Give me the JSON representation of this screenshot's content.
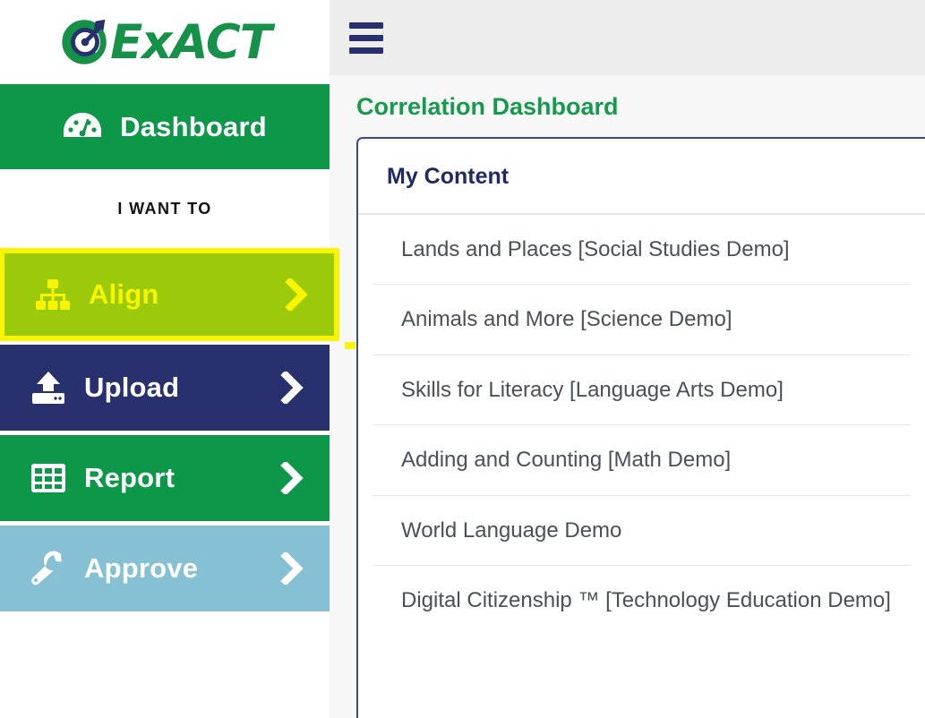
{
  "brand": {
    "logo_text": "ExACT",
    "logo_icon": "target-dart-icon",
    "green": "#159148",
    "navy": "#28306E"
  },
  "sidebar": {
    "dashboard": {
      "label": "Dashboard",
      "icon": "gauge-icon"
    },
    "section_label": "I WANT TO",
    "actions": [
      {
        "label": "Align",
        "icon": "sitemap-icon",
        "chevron": "❯",
        "bg": "#9ACA09",
        "fg": "#F9F500",
        "selected": true
      },
      {
        "label": "Upload",
        "icon": "upload-icon",
        "chevron": "❯",
        "bg": "#28306E",
        "fg": "#FFFFFF",
        "selected": false
      },
      {
        "label": "Report",
        "icon": "table-icon",
        "chevron": "❯",
        "bg": "#0C9749",
        "fg": "#FFFFFF",
        "selected": false
      },
      {
        "label": "Approve",
        "icon": "wrench-icon",
        "chevron": "❯",
        "bg": "#85C0D4",
        "fg": "#FFFFFF",
        "selected": false
      }
    ]
  },
  "header": {
    "menu_icon": "hamburger-menu-icon",
    "page_title": "Correlation Dashboard"
  },
  "content": {
    "card_title": "My Content",
    "items": [
      {
        "label": "Lands and Places [Social Studies Demo]"
      },
      {
        "label": "Animals and More [Science Demo]"
      },
      {
        "label": "Skills for Literacy [Language Arts Demo]"
      },
      {
        "label": "Adding and Counting [Math Demo]"
      },
      {
        "label": "World Language Demo"
      },
      {
        "label": "Digital Citizenship ™ [Technology Education Demo]"
      }
    ]
  }
}
